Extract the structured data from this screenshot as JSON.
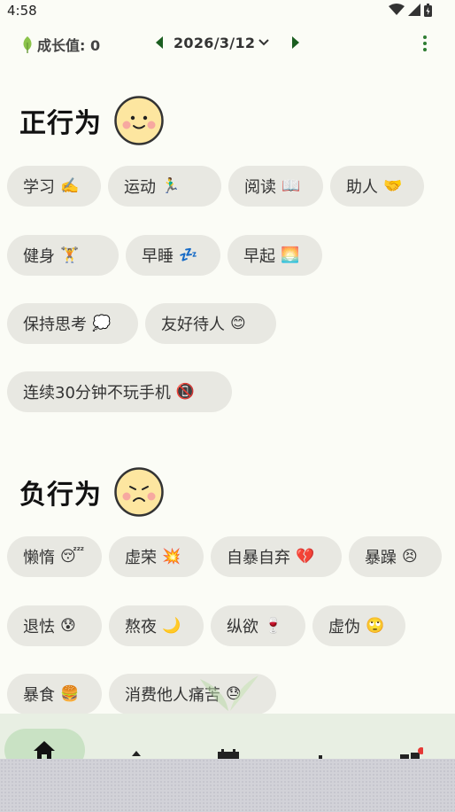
{
  "status": {
    "time": "4:58"
  },
  "header": {
    "growth_label": "成长值: 0",
    "date": "2026/3/12"
  },
  "positive": {
    "title": "正行为",
    "rows": [
      [
        {
          "label": "学习",
          "emoji": "✍️"
        },
        {
          "label": "运动",
          "emoji": "🏃‍♂️"
        },
        {
          "label": "阅读",
          "emoji": "📖"
        },
        {
          "label": "助人",
          "emoji": "🤝"
        }
      ],
      [
        {
          "label": "健身",
          "emoji": "🏋️"
        },
        {
          "label": "早睡",
          "emoji": "💤"
        },
        {
          "label": "早起",
          "emoji": "🌅"
        }
      ],
      [
        {
          "label": "保持思考",
          "emoji": "💭"
        },
        {
          "label": "友好待人",
          "emoji": "😊"
        }
      ],
      [
        {
          "label": "连续30分钟不玩手机",
          "emoji": "📵"
        }
      ]
    ]
  },
  "negative": {
    "title": "负行为",
    "rows": [
      [
        {
          "label": "懒惰",
          "emoji": "😴"
        },
        {
          "label": "虚荣",
          "emoji": "💥"
        },
        {
          "label": "自暴自弃",
          "emoji": "💔"
        },
        {
          "label": "暴躁",
          "emoji": "😣"
        }
      ],
      [
        {
          "label": "退怯",
          "emoji": "😰"
        },
        {
          "label": "熬夜",
          "emoji": "🌙"
        },
        {
          "label": "纵欲",
          "emoji": "🍷"
        },
        {
          "label": "虚伪",
          "emoji": "🙄"
        }
      ],
      [
        {
          "label": "暴食",
          "emoji": "🍔"
        },
        {
          "label": "消费他人痛苦",
          "emoji": "😓"
        }
      ]
    ]
  },
  "colors": {
    "accent_green": "#2e7d32",
    "chip_bg": "#e8e8e2",
    "nav_bg": "#e8efe3",
    "face_fill": "#fde6a0"
  },
  "icons": [
    "leaf-icon",
    "caret-left-icon",
    "caret-right-icon",
    "chevron-down-icon",
    "more-vert-icon",
    "home-icon",
    "calendar-icon"
  ]
}
